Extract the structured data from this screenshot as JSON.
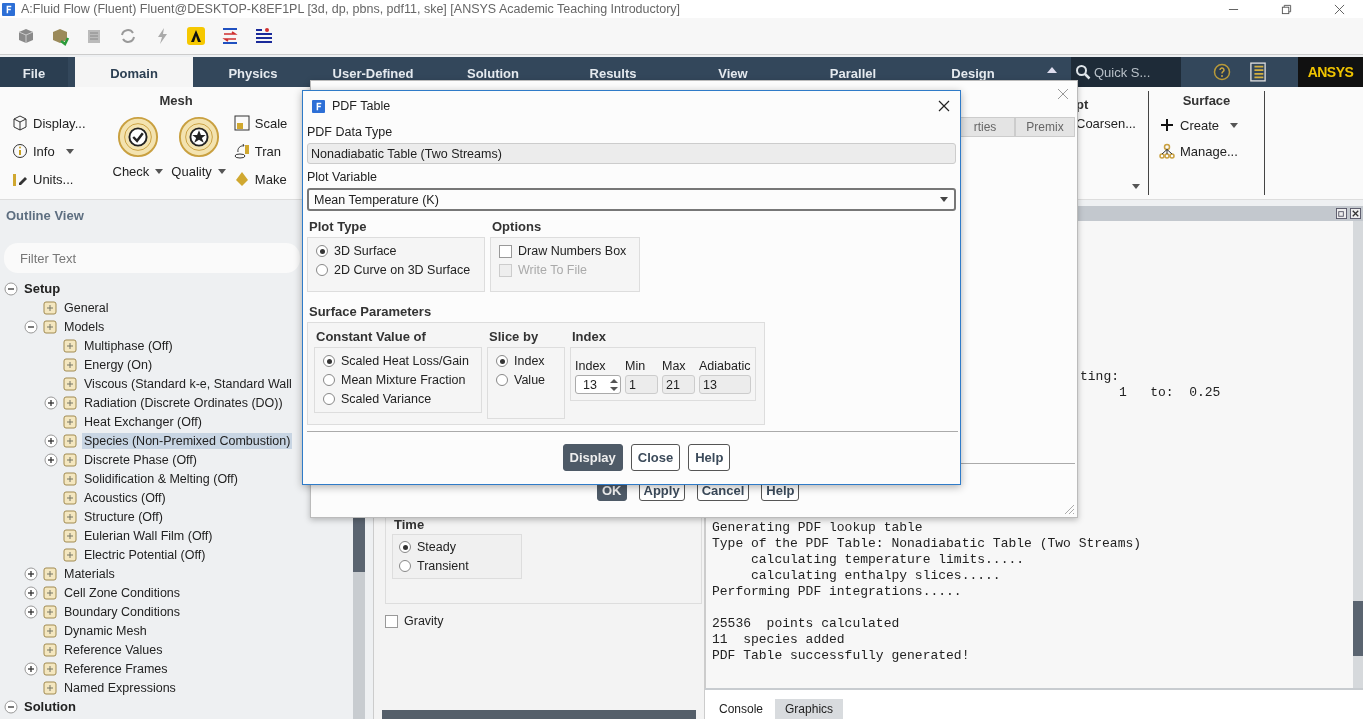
{
  "window": {
    "title": "A:Fluid Flow (Fluent) Fluent@DESKTOP-K8EF1PL  [3d, dp, pbns, pdf11, ske] [ANSYS Academic Teaching Introductory]"
  },
  "ribbon_tabs": [
    {
      "label": "File",
      "selected": false
    },
    {
      "label": "Domain",
      "selected": true
    },
    {
      "label": "Physics",
      "selected": false
    },
    {
      "label": "User-Defined",
      "selected": false
    },
    {
      "label": "Solution",
      "selected": false
    },
    {
      "label": "Results",
      "selected": false
    },
    {
      "label": "View",
      "selected": false
    },
    {
      "label": "Parallel",
      "selected": false
    },
    {
      "label": "Design",
      "selected": false
    }
  ],
  "quick_search": {
    "placeholder": "Quick S..."
  },
  "logo": "ANSYS",
  "mesh_group": {
    "title": "Mesh",
    "small_buttons": [
      {
        "label": "Display...",
        "dropdown": false
      },
      {
        "label": "Info",
        "dropdown": true
      },
      {
        "label": "Units...",
        "dropdown": false
      }
    ],
    "big_buttons": [
      {
        "label": "Check",
        "dropdown": true
      },
      {
        "label": "Quality",
        "dropdown": true
      }
    ],
    "partial_buttons": [
      "Scale",
      "Tran",
      "Make"
    ]
  },
  "adapt_group": {
    "title": "pt",
    "buttons": [
      "Coarsen..."
    ]
  },
  "surface_group": {
    "title": "Surface",
    "buttons": [
      {
        "label": "Create",
        "dropdown": true
      },
      {
        "label": "Manage...",
        "dropdown": false
      }
    ]
  },
  "outline": {
    "title": "Outline View",
    "filter_placeholder": "Filter Text",
    "tree": [
      {
        "label": "Setup",
        "expanded": true,
        "selected": false,
        "children": [
          {
            "label": "General",
            "selected": false
          },
          {
            "label": "Models",
            "expanded": true,
            "selected": false,
            "children": [
              {
                "label": "Multiphase (Off)",
                "selected": false
              },
              {
                "label": "Energy (On)",
                "selected": false
              },
              {
                "label": "Viscous (Standard k-e, Standard Wall",
                "selected": false
              },
              {
                "label": "Radiation (Discrete Ordinates (DO))",
                "expanded": false,
                "selected": false
              },
              {
                "label": "Heat Exchanger (Off)",
                "selected": false
              },
              {
                "label": "Species (Non-Premixed Combustion)",
                "expanded": false,
                "selected": true
              },
              {
                "label": "Discrete Phase (Off)",
                "expanded": false,
                "selected": false
              },
              {
                "label": "Solidification & Melting (Off)",
                "selected": false
              },
              {
                "label": "Acoustics (Off)",
                "selected": false
              },
              {
                "label": "Structure (Off)",
                "selected": false
              },
              {
                "label": "Eulerian Wall Film (Off)",
                "selected": false
              },
              {
                "label": "Electric Potential (Off)",
                "selected": false
              }
            ]
          },
          {
            "label": "Materials",
            "expanded": false,
            "selected": false
          },
          {
            "label": "Cell Zone Conditions",
            "expanded": false,
            "selected": false
          },
          {
            "label": "Boundary Conditions",
            "expanded": false,
            "selected": false
          },
          {
            "label": "Dynamic Mesh",
            "selected": false
          },
          {
            "label": "Reference Values",
            "selected": false
          },
          {
            "label": "Reference Frames",
            "expanded": false,
            "selected": false
          },
          {
            "label": "Named Expressions",
            "selected": false
          }
        ]
      },
      {
        "label": "Solution",
        "expanded": true,
        "selected": false
      }
    ]
  },
  "general_panel": {
    "time_title": "Time",
    "time_options": [
      {
        "label": "Steady",
        "selected": true
      },
      {
        "label": "Transient",
        "selected": false
      }
    ],
    "gravity": {
      "label": "Gravity",
      "checked": false
    }
  },
  "console": {
    "tail_lines": [
      "ting:",
      "     1   to:  0.25"
    ],
    "lines": [
      {
        "text": "Generating PDF lookup table",
        "kind": "line"
      },
      {
        "text": "Type of the PDF Table: Nonadiabatic Table (Two Streams)",
        "kind": "line"
      },
      {
        "text": "     calculating temperature limits.....",
        "kind": "line"
      },
      {
        "text": "     calculating enthalpy slices.....",
        "kind": "line"
      },
      {
        "text": "Performing PDF integrations.....",
        "kind": "line"
      },
      {
        "text": "25536  points calculated",
        "kind": "after-blank"
      },
      {
        "text": "11  species added",
        "kind": "line"
      },
      {
        "text": "PDF Table successfully generated!",
        "kind": "line"
      }
    ]
  },
  "bottom_tabs": [
    {
      "label": "Console",
      "selected": true
    },
    {
      "label": "Graphics",
      "selected": false
    }
  ],
  "species_dialog": {
    "tabs": [
      "rties",
      "Premix"
    ],
    "buttons": [
      {
        "label": "OK",
        "primary": true
      },
      {
        "label": "Apply",
        "primary": false
      },
      {
        "label": "Cancel",
        "primary": false
      },
      {
        "label": "Help",
        "primary": false
      }
    ]
  },
  "pdf_dialog": {
    "title": "PDF Table",
    "data_type_label": "PDF Data Type",
    "data_type": "Nonadiabatic Table (Two Streams)",
    "plot_variable_label": "Plot Variable",
    "plot_variable": "Mean Temperature (K)",
    "plot_type": {
      "title": "Plot Type",
      "options": [
        {
          "label": "3D Surface",
          "selected": true
        },
        {
          "label": "2D Curve on 3D Surface",
          "selected": false
        }
      ]
    },
    "options": {
      "title": "Options",
      "items": [
        {
          "label": "Draw Numbers Box",
          "checked": false,
          "disabled": false
        },
        {
          "label": "Write To File",
          "checked": false,
          "disabled": true
        }
      ]
    },
    "surface_parameters": {
      "title": "Surface Parameters",
      "constant_value": {
        "title": "Constant Value of",
        "options": [
          {
            "label": "Scaled Heat Loss/Gain",
            "selected": true
          },
          {
            "label": "Mean Mixture Fraction",
            "selected": false
          },
          {
            "label": "Scaled Variance",
            "selected": false
          }
        ]
      },
      "slice_by": {
        "title": "Slice by",
        "options": [
          {
            "label": "Index",
            "selected": true
          },
          {
            "label": "Value",
            "selected": false
          }
        ]
      },
      "index": {
        "title": "Index",
        "index_label": "Index",
        "index_value": "13",
        "min_label": "Min",
        "min": "1",
        "max_label": "Max",
        "max": "21",
        "adiabatic_label": "Adiabatic",
        "adiabatic": "13"
      }
    },
    "buttons": [
      {
        "label": "Display",
        "primary": true
      },
      {
        "label": "Close",
        "primary": false
      },
      {
        "label": "Help",
        "primary": false
      }
    ]
  }
}
